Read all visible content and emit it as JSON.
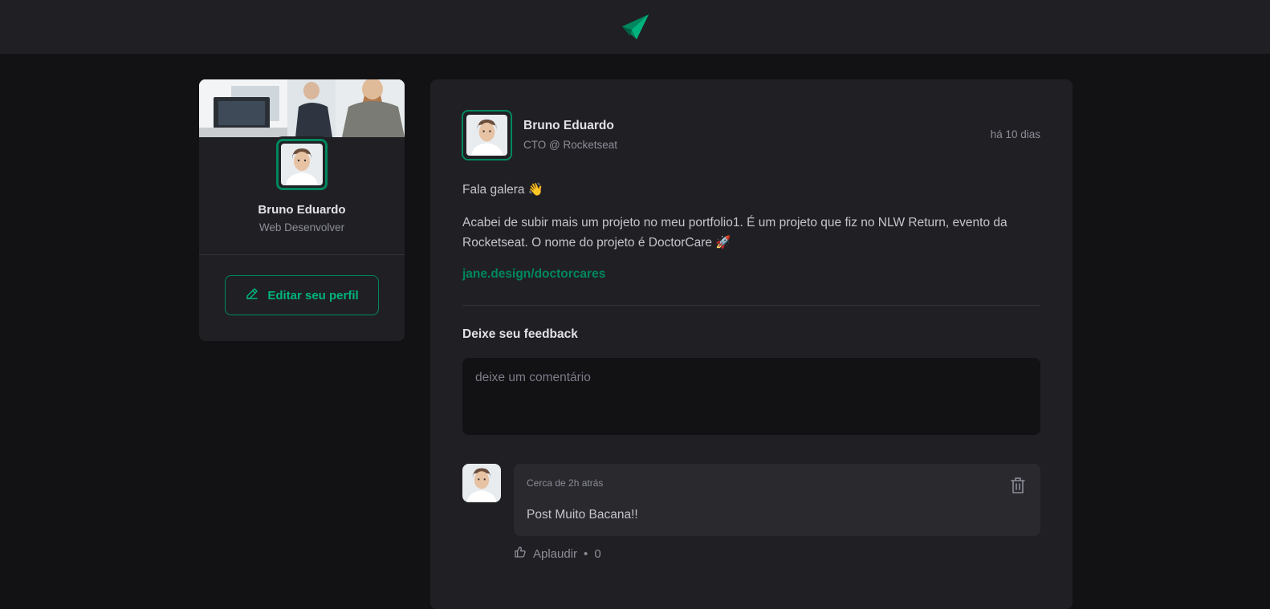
{
  "header": {
    "logo_icon": "paper-plane-icon"
  },
  "colors": {
    "accent": "#00875f",
    "accent_light": "#00b37e",
    "background": "#121214",
    "surface": "#202024"
  },
  "sidebar": {
    "cover_image": "workspace-cover-photo",
    "user_name": "Bruno Eduardo",
    "user_role": "Web Desenvolver",
    "edit_button_label": "Editar seu perfil",
    "edit_icon": "pencil-icon"
  },
  "post": {
    "author_name": "Bruno Eduardo",
    "author_role": "CTO @ Rocketseat",
    "published": "há 10 dias",
    "greeting": "Fala galera 👋",
    "body": "Acabei de subir mais um projeto no meu portfolio1. É um projeto que fiz no NLW Return, evento da Rocketseat. O nome do projeto é DoctorCare 🚀",
    "link": "jane.design/doctorcares",
    "feedback_title": "Deixe seu feedback",
    "comment_placeholder": "deixe um comentário"
  },
  "comments": [
    {
      "time": "Cerca de 2h atrás",
      "text": "Post Muito Bacana!!",
      "delete_icon": "trash-icon",
      "applaud_label": "Aplaudir",
      "applaud_separator": "•",
      "applaud_count": "0",
      "applaud_icon": "thumbs-up-icon"
    }
  ]
}
